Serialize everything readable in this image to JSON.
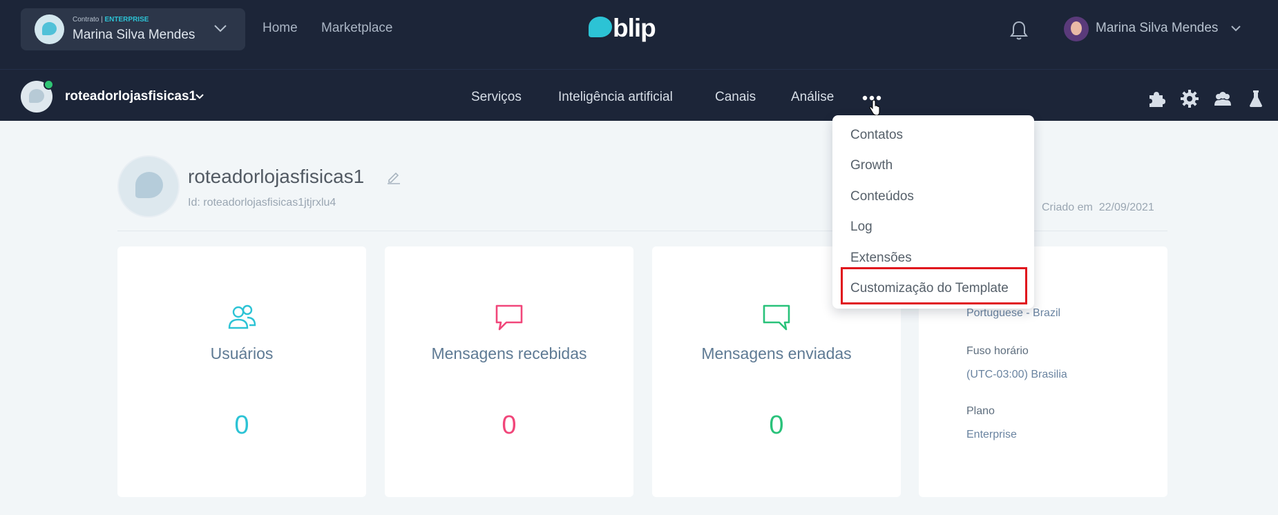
{
  "topbar": {
    "contract_prefix": "Contrato | ",
    "contract_plan": "ENTERPRISE",
    "contract_name": "Marina Silva Mendes",
    "nav": {
      "home": "Home",
      "marketplace": "Marketplace"
    },
    "logo_text": "blip",
    "user_name": "Marina Silva Mendes"
  },
  "subbar": {
    "bot_name": "roteadorlojasfisicas1",
    "nav": {
      "services": "Serviços",
      "ai": "Inteligência artificial",
      "channels": "Canais",
      "analysis": "Análise"
    }
  },
  "profile": {
    "title": "roteadorlojasfisicas1",
    "id": "Id: roteadorlojasfisicas1jtjrxlu4",
    "created_label": "Criado em",
    "created_date": "22/09/2021"
  },
  "cards": [
    {
      "title": "Usuários",
      "value": "0",
      "color": "#2cc3d5"
    },
    {
      "title": "Mensagens recebidas",
      "value": "0",
      "color": "#f1467a"
    },
    {
      "title": "Mensagens enviadas",
      "value": "0",
      "color": "#29c27a"
    }
  ],
  "info": {
    "language_value": "Portuguese - Brazil",
    "timezone_label": "Fuso horário",
    "timezone_value": "(UTC-03:00) Brasilia",
    "plan_label": "Plano",
    "plan_value": "Enterprise"
  },
  "dropdown": {
    "items": [
      "Contatos",
      "Growth",
      "Conteúdos",
      "Log",
      "Extensões",
      "Customização do Template"
    ]
  },
  "colors": {
    "nav_bg": "#1c2538",
    "accent": "#2cc3d5",
    "highlight": "#e0121c"
  }
}
